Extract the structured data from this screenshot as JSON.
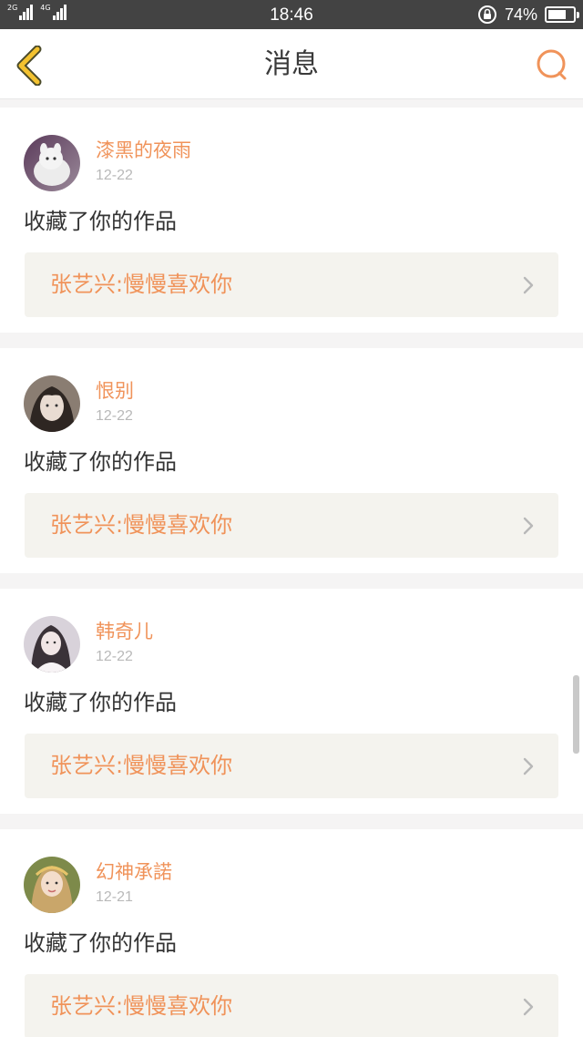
{
  "status_bar": {
    "network_1": "2G",
    "network_2": "4G",
    "time": "18:46",
    "battery_percent": "74%",
    "battery_level": 0.74
  },
  "header": {
    "title": "消息",
    "back_icon": "chevron-left-icon",
    "search_icon": "search-icon"
  },
  "colors": {
    "accent": "#f0935a",
    "back_icon": "#f3c230"
  },
  "messages": [
    {
      "username": "漆黑的夜雨",
      "date": "12-22",
      "action": "收藏了你的作品",
      "work": "张艺兴:慢慢喜欢你"
    },
    {
      "username": "恨别",
      "date": "12-22",
      "action": "收藏了你的作品",
      "work": "张艺兴:慢慢喜欢你"
    },
    {
      "username": "韩奇儿",
      "date": "12-22",
      "action": "收藏了你的作品",
      "work": "张艺兴:慢慢喜欢你"
    },
    {
      "username": "幻神承諾",
      "date": "12-21",
      "action": "收藏了你的作品",
      "work": "张艺兴:慢慢喜欢你"
    }
  ]
}
